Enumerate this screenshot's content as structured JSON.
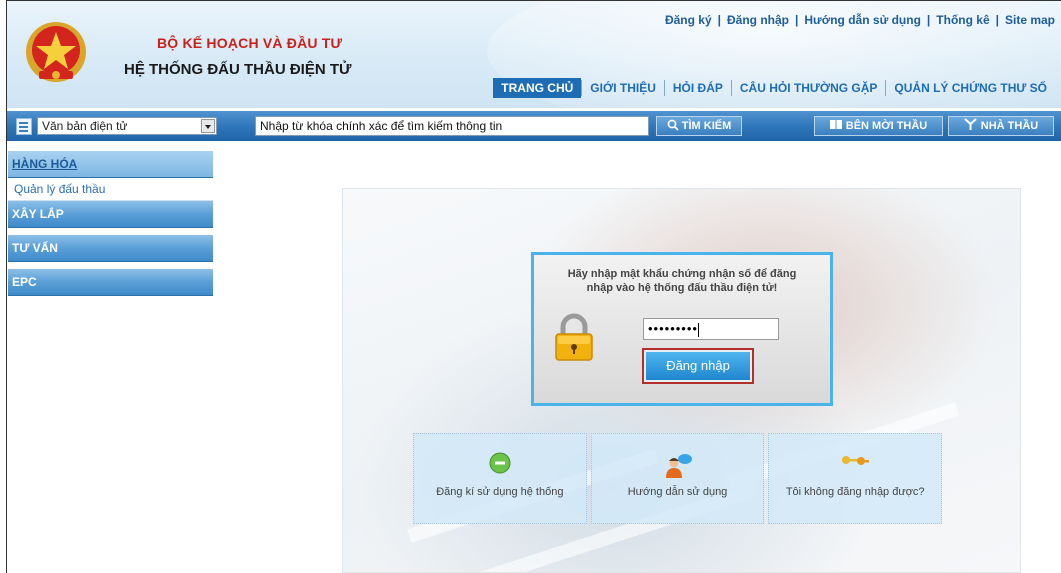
{
  "header": {
    "ministry": "BỘ KẾ HOẠCH VÀ ĐẦU TƯ",
    "system_name": "HỆ THỐNG ĐẤU THẦU ĐIỆN TỬ",
    "top_links": [
      "Đăng ký",
      "Đăng nhập",
      "Hướng dẫn sử dụng",
      "Thống kê",
      "Site map"
    ],
    "separator": "|",
    "nav": [
      "TRANG CHỦ",
      "GIỚI THIỆU",
      "HỎI ĐÁP",
      "CÂU HỎI THƯỜNG GẶP",
      "QUẢN LÝ CHỨNG THƯ SỐ"
    ],
    "accent": "#1e6cb4",
    "ministry_color": "#c8211c"
  },
  "searchbar": {
    "doc_type": "Văn bản điện tử",
    "search_value": "Nhập từ khóa chính xác để tìm kiếm thông tin",
    "search_button": "TÌM KIẾM",
    "bmt_button": "BÊN MỜI THẦU",
    "nt_button": "NHÀ THẦU"
  },
  "sidebar": {
    "categories": [
      {
        "label": "HÀNG HÓA",
        "active": true
      },
      {
        "label": "XÂY LẮP"
      },
      {
        "label": "TƯ VẤN"
      },
      {
        "label": "EPC"
      }
    ],
    "subitem": "Quản lý đấu thầu"
  },
  "login": {
    "message_line1": "Hãy nhập mật khẩu chứng nhận số để đăng",
    "message_line2": "nhập vào hệ thống đấu thầu điện tử!",
    "password_mask": "•••••••••",
    "button": "Đăng nhập",
    "icons": [
      "padlock-icon"
    ]
  },
  "quick_links": [
    {
      "label": "Đăng kí sử dụng hệ thống",
      "icon": "register-icon"
    },
    {
      "label": "Hướng dẫn sử dụng",
      "icon": "user-guide-icon"
    },
    {
      "label": "Tôi không đăng nhập được?",
      "icon": "keys-icon"
    }
  ]
}
